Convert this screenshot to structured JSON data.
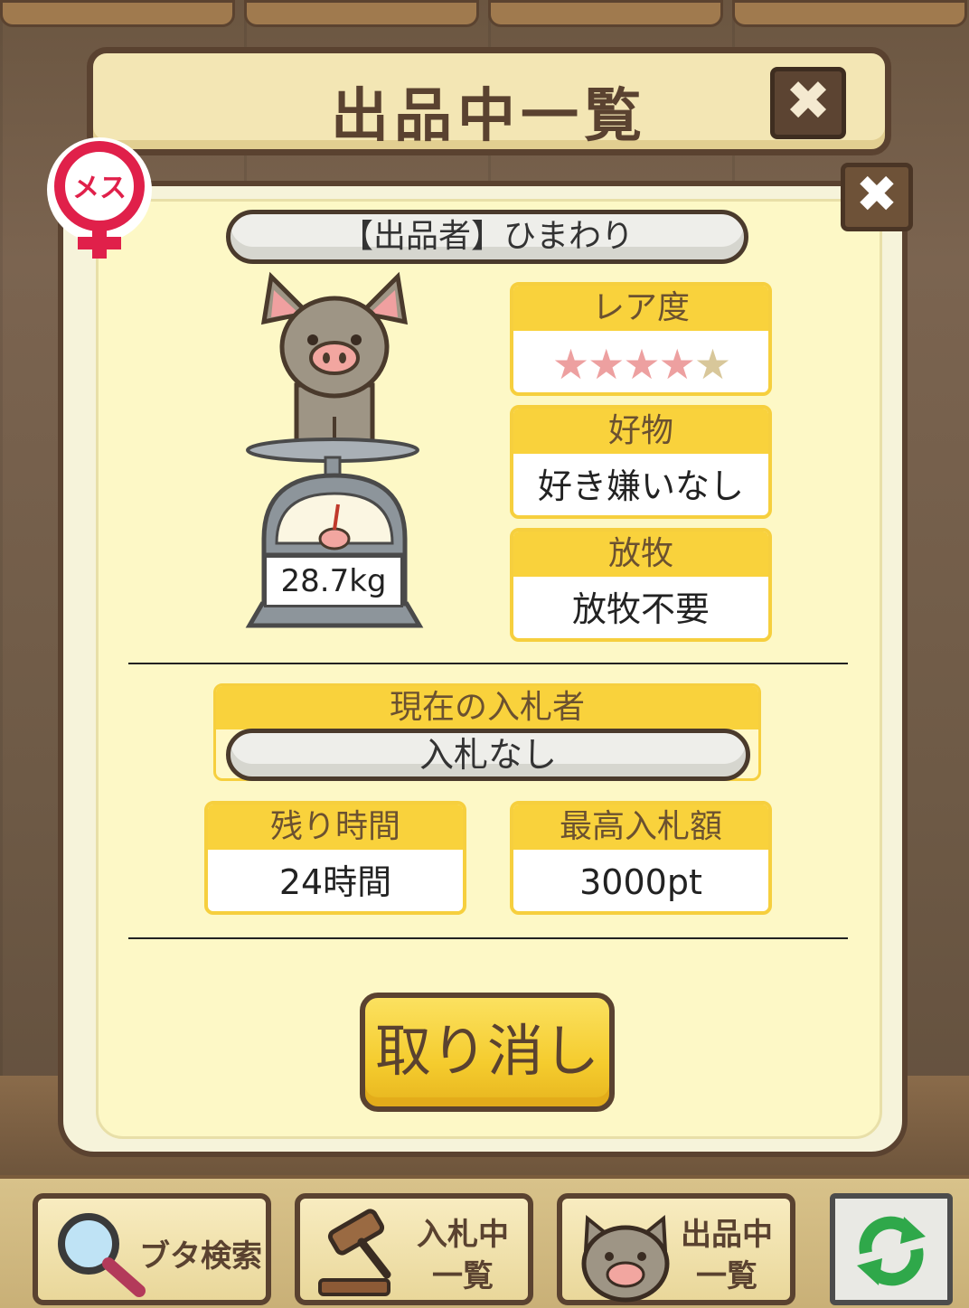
{
  "header": {
    "title": "出品中一覧",
    "close_label": "✖"
  },
  "modal": {
    "close_label": "✖",
    "gender_label": "メス",
    "seller": "【出品者】ひまわり",
    "weight": "28.7kg",
    "rarity": {
      "label": "レア度",
      "value": 4,
      "max": 5,
      "star_on_color": "#eda0a0",
      "star_off_color": "#d8c79a"
    },
    "favorite": {
      "label": "好物",
      "value": "好き嫌いなし"
    },
    "grazing": {
      "label": "放牧",
      "value": "放牧不要"
    },
    "bidder": {
      "label": "現在の入札者",
      "value": "入札なし"
    },
    "time_left": {
      "label": "残り時間",
      "value": "24時間"
    },
    "max_bid": {
      "label": "最高入札額",
      "value": "3000pt"
    },
    "cancel_label": "取り消し"
  },
  "nav": {
    "search": {
      "label": "ブタ検索",
      "icon": "magnifier-icon"
    },
    "bidding": {
      "line1": "入札中",
      "line2": "一覧",
      "icon": "gavel-icon"
    },
    "listing": {
      "line1": "出品中",
      "line2": "一覧",
      "icon": "pig-icon"
    },
    "refresh": {
      "icon": "refresh-icon"
    }
  },
  "colors": {
    "accent": "#f9d23c",
    "border": "#5a4230",
    "panel": "#fdf8c6"
  }
}
